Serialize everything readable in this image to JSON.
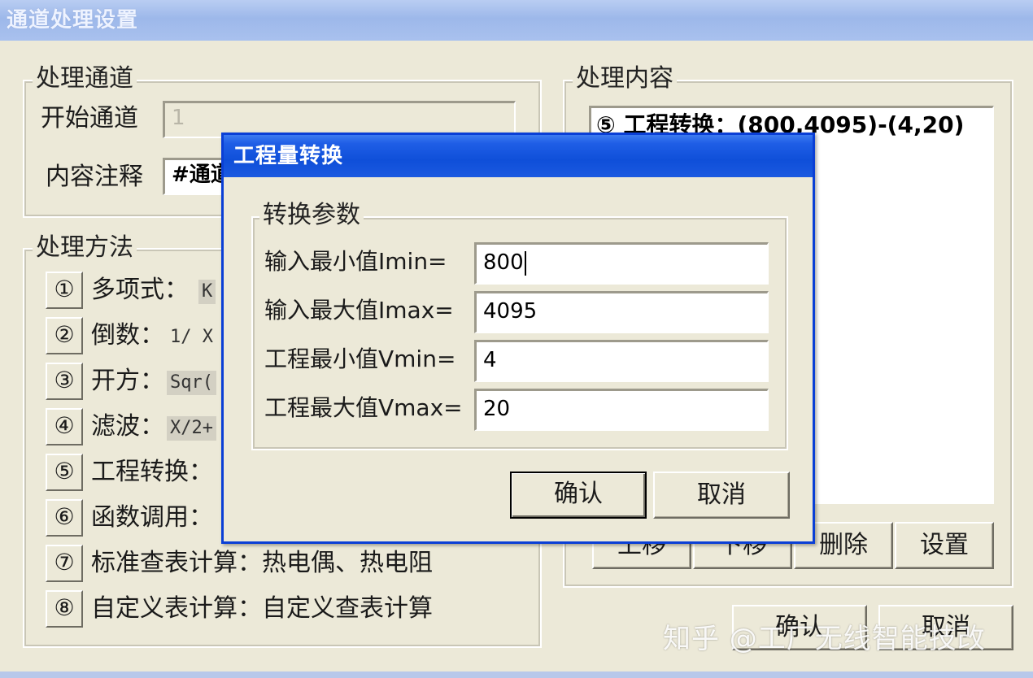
{
  "window": {
    "title": "通道处理设置"
  },
  "channel_group": {
    "legend": "处理通道",
    "start_label": "开始通道",
    "start_value": "1",
    "comment_label": "内容注释",
    "comment_value": "#通道"
  },
  "method_group": {
    "legend": "处理方法",
    "items": [
      {
        "num": "①",
        "label": "多项式：",
        "expr": "K"
      },
      {
        "num": "②",
        "label": "倒数：",
        "expr": "1/ X"
      },
      {
        "num": "③",
        "label": "开方：",
        "expr": "Sqr("
      },
      {
        "num": "④",
        "label": "滤波：",
        "expr": "X/2+"
      },
      {
        "num": "⑤",
        "label": "工程转换：",
        "expr": ""
      },
      {
        "num": "⑥",
        "label": "函数调用：",
        "expr": ""
      },
      {
        "num": "⑦",
        "label": "标准查表计算：热电偶、热电阻",
        "expr": ""
      },
      {
        "num": "⑧",
        "label": "自定义表计算：自定义查表计算",
        "expr": ""
      }
    ]
  },
  "content_group": {
    "legend": "处理内容",
    "list": [
      "⑤ 工程转换：(800,4095)-(4,20)"
    ],
    "buttons": {
      "up": "上移",
      "down": "下移",
      "delete": "删除",
      "settings": "设置"
    }
  },
  "main_buttons": {
    "confirm": "确认",
    "cancel": "取消"
  },
  "dialog": {
    "title": "工程量转换",
    "group_legend": "转换参数",
    "fields": [
      {
        "label": "输入最小值Imin=",
        "value": "800"
      },
      {
        "label": "输入最大值Imax=",
        "value": "4095"
      },
      {
        "label": "工程最小值Vmin=",
        "value": "4"
      },
      {
        "label": "工程最大值Vmax=",
        "value": "20"
      }
    ],
    "confirm": "确认",
    "cancel": "取消"
  },
  "watermark": "知乎 @工厂无线智能技改"
}
